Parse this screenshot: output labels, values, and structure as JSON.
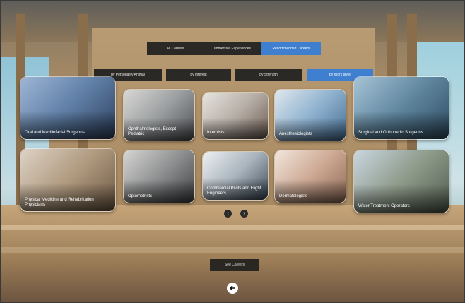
{
  "top_tabs": [
    {
      "label": "All Careers",
      "active": false
    },
    {
      "label": "Immersive Experiences",
      "active": false
    },
    {
      "label": "Recommended Careers",
      "active": true
    }
  ],
  "filter_tabs": [
    {
      "label": "by Personality Animal",
      "active": false
    },
    {
      "label": "by Interest",
      "active": false
    },
    {
      "label": "by Strength",
      "active": false
    },
    {
      "label": "by Work style",
      "active": true
    }
  ],
  "cards": [
    {
      "label": "Oral and Maxillofacial Surgeons"
    },
    {
      "label": "Ophthalmologists, Except Pediatric"
    },
    {
      "label": "Internists"
    },
    {
      "label": "Anesthesiologists"
    },
    {
      "label": "Surgical and Orthopedic Surgeons"
    },
    {
      "label": "Physical Medicine and Rehabilitation Physicians"
    },
    {
      "label": "Optometrists"
    },
    {
      "label": "Commercial Pilots and Flight Engineers"
    },
    {
      "label": "Dermatologists"
    },
    {
      "label": "Water Treatment Operators"
    }
  ],
  "see_careers_button": "See Careers",
  "colors": {
    "accent": "#3e7fd0",
    "dark": "#2b2926"
  },
  "icons": {
    "prev": "chevron-left-icon",
    "next": "chevron-right-icon",
    "back": "arrow-left-icon"
  }
}
